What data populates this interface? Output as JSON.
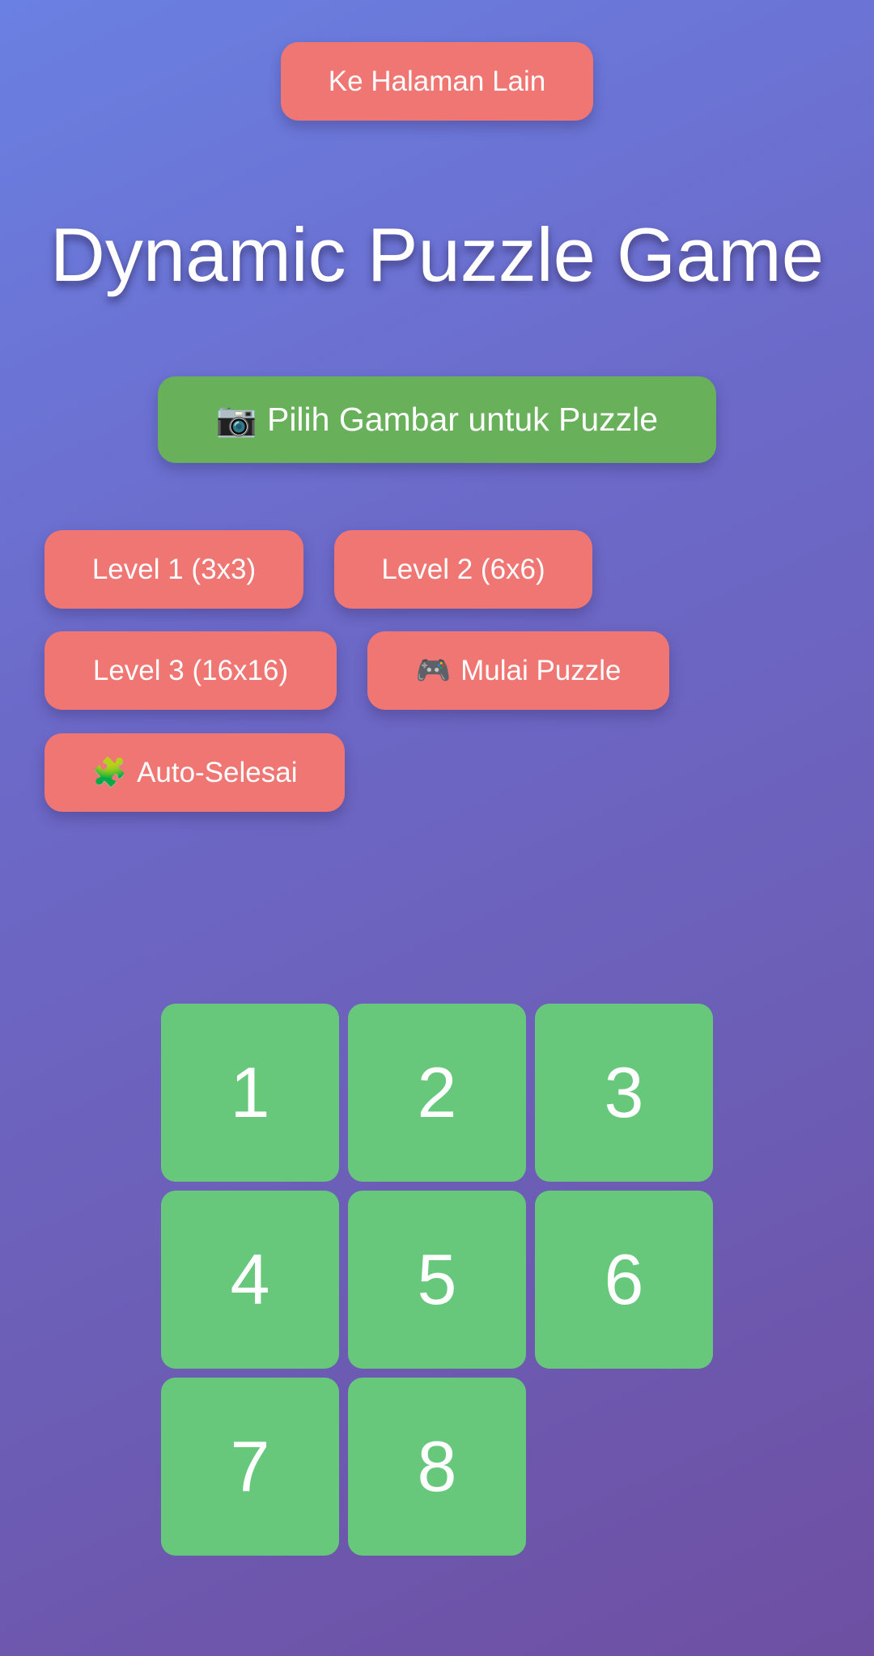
{
  "nav": {
    "other_page_label": "Ke Halaman Lain"
  },
  "header": {
    "title": "Dynamic Puzzle Game"
  },
  "image_picker": {
    "icon": "📷",
    "label": "Pilih Gambar untuk Puzzle"
  },
  "controls": {
    "level1": "Level 1 (3x3)",
    "level2": "Level 2 (6x6)",
    "level3": "Level 3 (16x16)",
    "start_icon": "🎮",
    "start_label": "Mulai Puzzle",
    "auto_icon": "🧩",
    "auto_label": "Auto-Selesai"
  },
  "board": {
    "size": 3,
    "tiles": [
      "1",
      "2",
      "3",
      "4",
      "5",
      "6",
      "7",
      "8",
      ""
    ]
  },
  "colors": {
    "red_button": "#ef7672",
    "green_button": "#69b05b",
    "tile": "#67c87c",
    "text": "#ffffff"
  }
}
